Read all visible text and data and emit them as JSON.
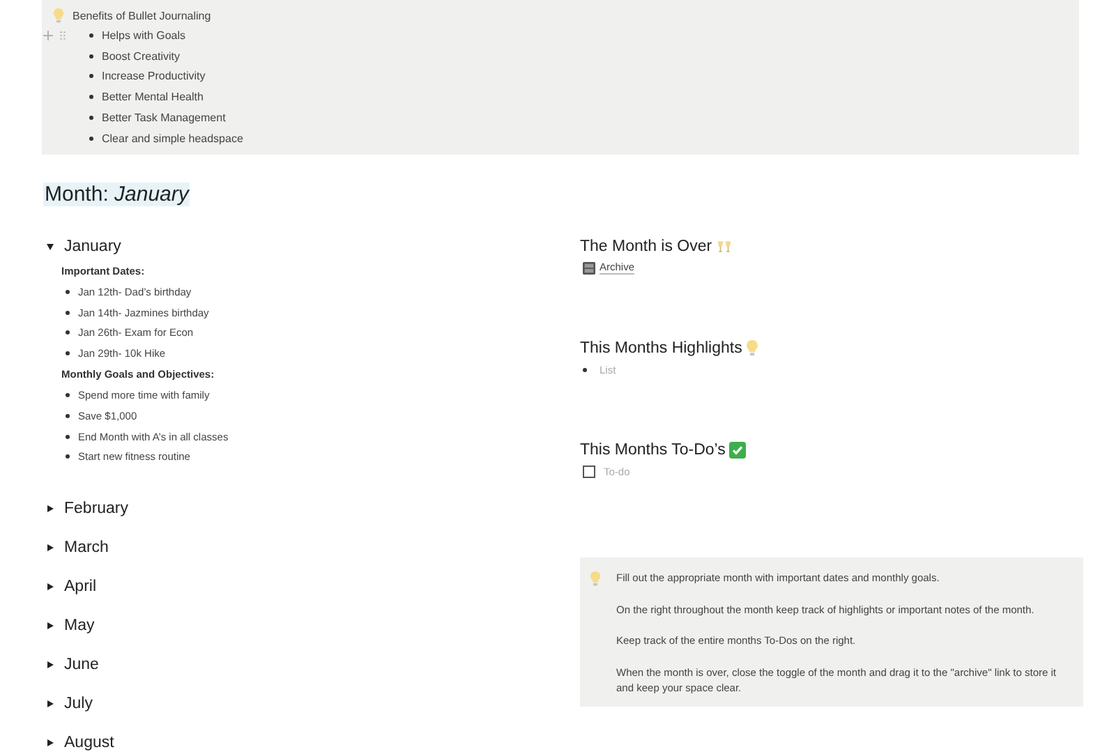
{
  "benefits": {
    "title": "Benefits of Bullet Journaling",
    "items": [
      {
        "text": "Helps with Goals",
        "hovered": true
      },
      {
        "text": "Boost Creativity",
        "hovered": false
      },
      {
        "text": "Increase Productivity",
        "hovered": false
      },
      {
        "text": "Better Mental Health",
        "hovered": false
      },
      {
        "text": "Better Task Management",
        "hovered": false
      },
      {
        "text": "Clear and simple headspace",
        "hovered": false
      }
    ]
  },
  "page_heading": {
    "label": "Month: ",
    "value": "January"
  },
  "months": [
    {
      "name": "January",
      "expanded": true,
      "sections": [
        {
          "title": "Important Dates:",
          "items": [
            "Jan 12th- Dad’s birthday",
            "Jan 14th- Jazmines birthday",
            "Jan 26th- Exam for Econ",
            "Jan 29th- 10k Hike"
          ]
        },
        {
          "title": "Monthly Goals and Objectives:",
          "items": [
            "Spend more time with family",
            "Save $1,000",
            "End Month with A’s in all classes",
            "Start new fitness routine"
          ]
        }
      ]
    },
    {
      "name": "February",
      "expanded": false
    },
    {
      "name": "March",
      "expanded": false
    },
    {
      "name": "April",
      "expanded": false
    },
    {
      "name": "May",
      "expanded": false
    },
    {
      "name": "June",
      "expanded": false
    },
    {
      "name": "July",
      "expanded": false
    },
    {
      "name": "August",
      "expanded": false
    }
  ],
  "right_blocks": [
    {
      "heading": "The Month is Over",
      "kind": "link",
      "text": "Archive"
    },
    {
      "heading": "This Months Highlights",
      "kind": "bullet",
      "text": "List"
    },
    {
      "heading": "This Months To-Do’s",
      "kind": "todo",
      "text": "To-do",
      "checked": false
    }
  ],
  "instructions": [
    "Fill out the appropriate month with important dates and monthly goals.",
    "On the right throughout the month keep track of highlights or important notes of the month.",
    "Keep track of the entire months To-Dos on the right.",
    "When the month is over, close the toggle of the month and drag it to the \"archive\" link to store it and keep your space clear."
  ]
}
